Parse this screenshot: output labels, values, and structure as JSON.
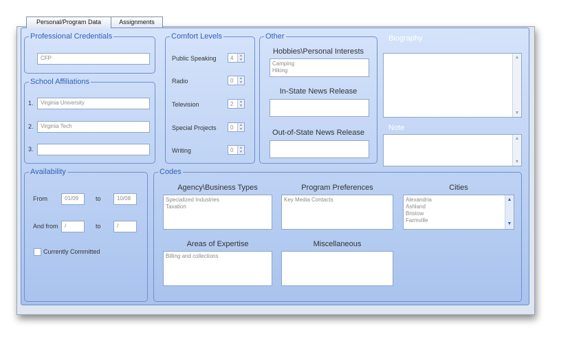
{
  "tabs": [
    {
      "label": "Personal/Program Data",
      "active": true
    },
    {
      "label": "Assignments",
      "active": false
    }
  ],
  "professional_credentials": {
    "legend": "Professional Credentials",
    "value": "CFP"
  },
  "school_affiliations": {
    "legend": "School Affiliations",
    "rows": [
      {
        "num": "1.",
        "value": "Virginia University"
      },
      {
        "num": "2.",
        "value": "Virginia Tech"
      },
      {
        "num": "3.",
        "value": ""
      }
    ]
  },
  "comfort_levels": {
    "legend": "Comfort Levels",
    "items": [
      {
        "label": "Public Speaking",
        "value": "4"
      },
      {
        "label": "Radio",
        "value": "0"
      },
      {
        "label": "Television",
        "value": "2"
      },
      {
        "label": "Special Projects",
        "value": "0"
      },
      {
        "label": "Writing",
        "value": "0"
      }
    ]
  },
  "other": {
    "legend": "Other",
    "hobbies_label": "Hobbies\\Personal Interests",
    "hobbies": [
      "Camping",
      "Hiking"
    ],
    "instate_label": "In-State News Release",
    "outofstate_label": "Out-of-State News Release"
  },
  "biography": {
    "label": "Biography"
  },
  "note": {
    "label": "Note"
  },
  "availability": {
    "legend": "Availability",
    "from_label": "From",
    "from_value": "01/09",
    "to_label": "to",
    "to_value": "10/08",
    "and_from_label": "And from",
    "and_from_value": "/",
    "to2_label": "to",
    "to2_value": "/",
    "committed_label": "Currently Committed"
  },
  "codes": {
    "legend": "Codes",
    "agency_label": "Agency\\Business Types",
    "agency_items": [
      "Specialized Industries",
      "Taxation"
    ],
    "program_label": "Program Preferences",
    "program_items": [
      "Key Media Contacts"
    ],
    "cities_label": "Cities",
    "cities_items": [
      "Alexandria",
      "Ashland",
      "Bristow",
      "Farmville"
    ],
    "expertise_label": "Areas of Expertise",
    "expertise_items": [
      "Billing and collections"
    ],
    "misc_label": "Miscellaneous"
  }
}
